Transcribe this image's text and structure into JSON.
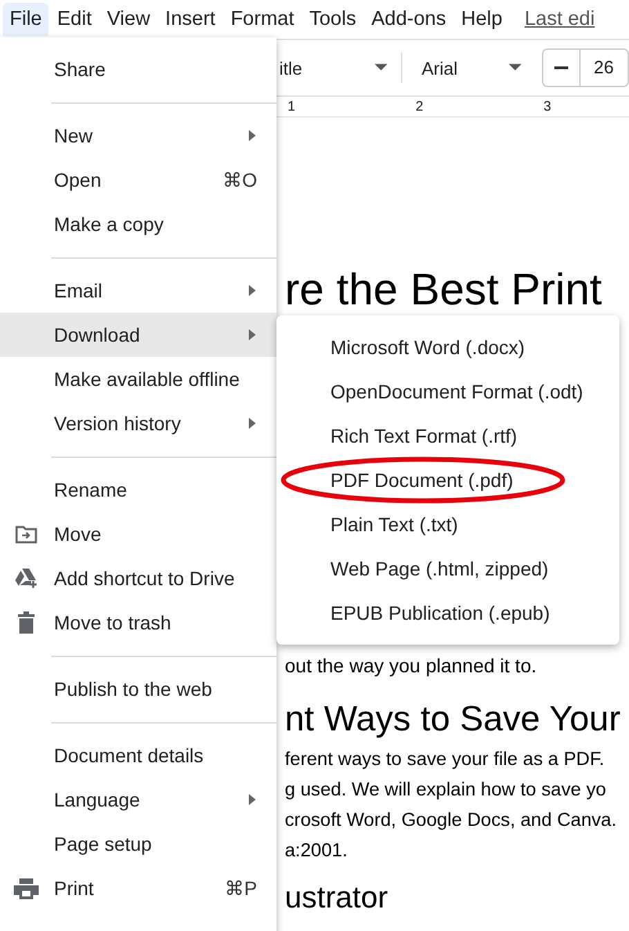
{
  "menubar": {
    "items": [
      {
        "label": "File",
        "selected": true
      },
      {
        "label": "Edit",
        "selected": false
      },
      {
        "label": "View",
        "selected": false
      },
      {
        "label": "Insert",
        "selected": false
      },
      {
        "label": "Format",
        "selected": false
      },
      {
        "label": "Tools",
        "selected": false
      },
      {
        "label": "Add-ons",
        "selected": false
      },
      {
        "label": "Help",
        "selected": false
      }
    ],
    "last_edit": "Last edi"
  },
  "toolbar": {
    "style": "itle",
    "font": "Arial",
    "size": "26"
  },
  "ruler": [
    "1",
    "2",
    "3"
  ],
  "document": {
    "title": "re the Best Print",
    "line": "out the way you planned it to.",
    "heading": "nt Ways to Save Your",
    "paragraph": [
      "ferent ways to save your file as a PDF.",
      "g used. We will explain how to save yo",
      "crosoft Word, Google Docs, and Canva.",
      "a:2001."
    ],
    "subheading": "ustrator"
  },
  "file_menu": [
    {
      "kind": "plain",
      "label": "Share",
      "selected": false
    },
    {
      "kind": "divider"
    },
    {
      "kind": "plain",
      "label": "New",
      "submenu": true,
      "selected": false
    },
    {
      "kind": "plain",
      "label": "Open",
      "shortcut": "⌘O",
      "selected": false
    },
    {
      "kind": "plain",
      "label": "Make a copy",
      "selected": false
    },
    {
      "kind": "divider"
    },
    {
      "kind": "plain",
      "label": "Email",
      "submenu": true,
      "selected": false
    },
    {
      "kind": "plain",
      "label": "Download",
      "submenu": true,
      "selected": true
    },
    {
      "kind": "plain",
      "label": "Make available offline",
      "selected": false
    },
    {
      "kind": "plain",
      "label": "Version history",
      "submenu": true,
      "selected": false
    },
    {
      "kind": "divider"
    },
    {
      "kind": "plain",
      "label": "Rename",
      "selected": false
    },
    {
      "kind": "folder",
      "label": "Move",
      "selected": false
    },
    {
      "kind": "drive",
      "label": "Add shortcut to Drive",
      "selected": false
    },
    {
      "kind": "trash",
      "label": "Move to trash",
      "selected": false
    },
    {
      "kind": "divider"
    },
    {
      "kind": "plain",
      "label": "Publish to the web",
      "selected": false
    },
    {
      "kind": "divider"
    },
    {
      "kind": "plain",
      "label": "Document details",
      "selected": false
    },
    {
      "kind": "plain",
      "label": "Language",
      "submenu": true,
      "selected": false
    },
    {
      "kind": "plain",
      "label": "Page setup",
      "selected": false
    },
    {
      "kind": "printer",
      "label": "Print",
      "shortcut": "⌘P",
      "selected": false
    }
  ],
  "download_menu": [
    {
      "label": "Microsoft Word (.docx)",
      "circled": false
    },
    {
      "label": "OpenDocument Format (.odt)",
      "circled": false
    },
    {
      "label": "Rich Text Format (.rtf)",
      "circled": false
    },
    {
      "label": "PDF Document (.pdf)",
      "circled": true
    },
    {
      "label": "Plain Text (.txt)",
      "circled": false
    },
    {
      "label": "Web Page (.html, zipped)",
      "circled": false
    },
    {
      "label": "EPUB Publication (.epub)",
      "circled": false
    }
  ]
}
